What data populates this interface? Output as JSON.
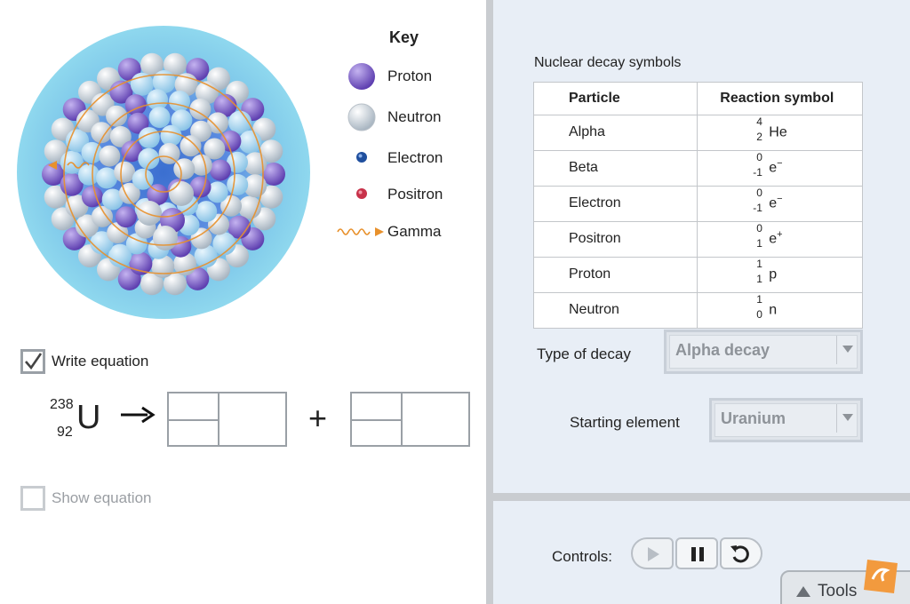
{
  "key": {
    "title": "Key",
    "items": [
      {
        "label": "Proton",
        "icon": "proton-icon",
        "color": "#7b5cc4"
      },
      {
        "label": "Neutron",
        "icon": "neutron-icon",
        "color": "#e6e8ea"
      },
      {
        "label": "Electron",
        "icon": "electron-icon",
        "color": "#1f4f9e"
      },
      {
        "label": "Positron",
        "icon": "positron-icon",
        "color": "#c8324a"
      },
      {
        "label": "Gamma",
        "icon": "gamma-wave-icon",
        "color": "#e8912c"
      }
    ]
  },
  "equation": {
    "write_label": "Write equation",
    "write_checked": true,
    "mass_number": "238",
    "atomic_number": "92",
    "symbol": "U",
    "plus": "+",
    "show_label": "Show equation",
    "show_checked": false
  },
  "table": {
    "title": "Nuclear decay symbols",
    "headers": [
      "Particle",
      "Reaction symbol"
    ],
    "rows": [
      {
        "particle": "Alpha",
        "sup": "4",
        "sub": "2",
        "symbol": "He",
        "charge": ""
      },
      {
        "particle": "Beta",
        "sup": "0",
        "sub": "-1",
        "symbol": "e",
        "charge": "−"
      },
      {
        "particle": "Electron",
        "sup": "0",
        "sub": "-1",
        "symbol": "e",
        "charge": "−"
      },
      {
        "particle": "Positron",
        "sup": "0",
        "sub": "1",
        "symbol": "e",
        "charge": "+"
      },
      {
        "particle": "Proton",
        "sup": "1",
        "sub": "1",
        "symbol": "p",
        "charge": ""
      },
      {
        "particle": "Neutron",
        "sup": "1",
        "sub": "0",
        "symbol": "n",
        "charge": ""
      }
    ]
  },
  "settings": {
    "type_label": "Type of decay",
    "type_value": "Alpha decay",
    "start_label": "Starting element",
    "start_value": "Uranium"
  },
  "controls": {
    "label": "Controls:"
  },
  "tools": {
    "label": "Tools"
  },
  "colors": {
    "proton": "#7b5cc4",
    "neutron": "#e6e8ea",
    "panel_bg": "#e8eef6",
    "gamma": "#e8912c"
  }
}
